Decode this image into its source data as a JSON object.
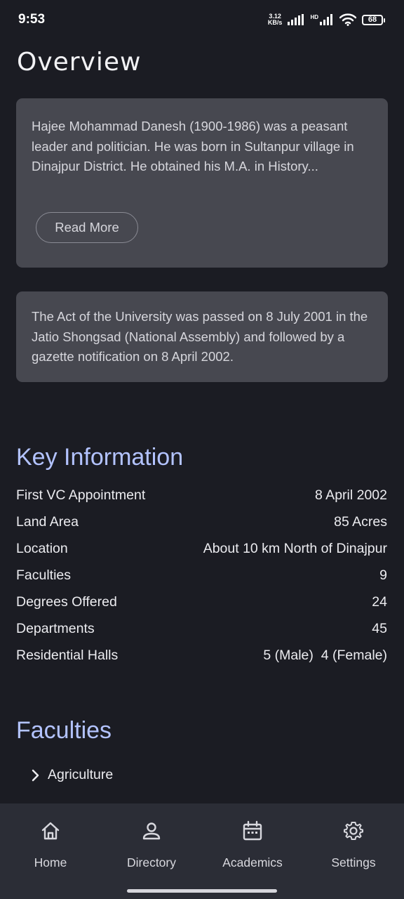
{
  "status_bar": {
    "time": "9:53",
    "net_speed_value": "3.12",
    "net_speed_unit": "KB/s",
    "hd_label": "HD",
    "battery": "68"
  },
  "overview": {
    "title": "Overview",
    "card1_text": "Hajee Mohammad Danesh (1900-1986) was a peasant leader and politician. He was born in Sultanpur village in Dinajpur District. He obtained his M.A. in History...",
    "read_more_label": "Read More",
    "card2_text": "The Act of the University was passed on 8 July 2001 in the Jatio Shongsad (National Assembly) and followed by a gazette notification on 8 April 2002."
  },
  "key_info": {
    "title": "Key Information",
    "rows": [
      {
        "label": "First VC Appointment",
        "value": "8 April 2002"
      },
      {
        "label": "Land Area",
        "value": "85 Acres"
      },
      {
        "label": "Location",
        "value": "About 10 km North of Dinajpur"
      },
      {
        "label": "Faculties",
        "value": "9"
      },
      {
        "label": "Degrees Offered",
        "value": "24"
      },
      {
        "label": "Departments",
        "value": "45"
      },
      {
        "label": "Residential Halls",
        "value": "5 (Male)  4 (Female)"
      }
    ]
  },
  "faculties": {
    "title": "Faculties",
    "items": [
      {
        "label": "Agriculture",
        "icon": "chevron-right-icon"
      }
    ]
  },
  "bottom_nav": {
    "items": [
      {
        "label": "Home",
        "icon": "home-icon"
      },
      {
        "label": "Directory",
        "icon": "person-icon"
      },
      {
        "label": "Academics",
        "icon": "calendar-icon"
      },
      {
        "label": "Settings",
        "icon": "gear-icon"
      }
    ]
  }
}
